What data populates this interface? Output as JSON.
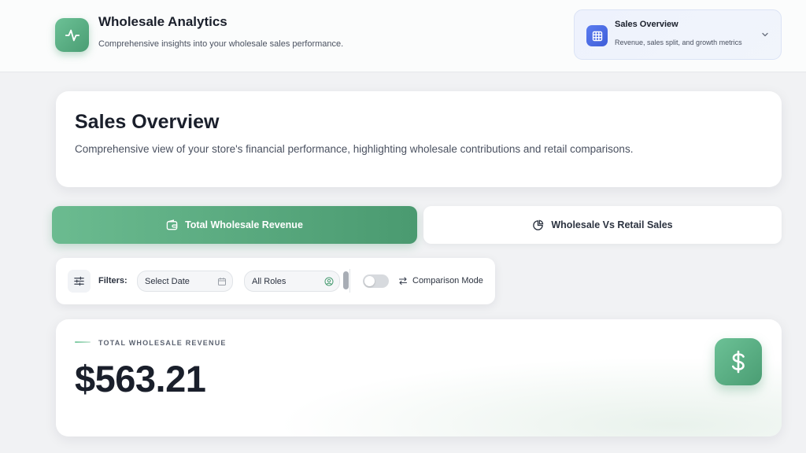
{
  "header": {
    "app_title": "Wholesale Analytics",
    "app_subtitle": "Comprehensive insights into your wholesale sales performance.",
    "logo_icon": "activity-icon",
    "nav": {
      "title": "Sales Overview",
      "subtitle": "Revenue, sales split, and growth metrics",
      "icon": "grid-icon"
    }
  },
  "overview": {
    "title": "Sales Overview",
    "description": "Comprehensive view of your store's financial performance, highlighting wholesale contributions and retail comparisons."
  },
  "tabs": [
    {
      "label": "Total Wholesale Revenue",
      "icon": "wallet-icon",
      "active": true
    },
    {
      "label": "Wholesale Vs Retail Sales",
      "icon": "pie-chart-icon",
      "active": false
    }
  ],
  "filters": {
    "label": "Filters:",
    "date_placeholder": "Select Date",
    "role_value": "All Roles",
    "comparison_label": "Comparison Mode",
    "comparison_enabled": false
  },
  "revenue": {
    "label": "TOTAL WHOLESALE REVENUE",
    "value": "$563.21",
    "icon": "dollar-icon"
  },
  "colors": {
    "accent_green": "#4a9d73",
    "accent_blue": "#3f5ed8",
    "background": "#f1f2f4"
  }
}
